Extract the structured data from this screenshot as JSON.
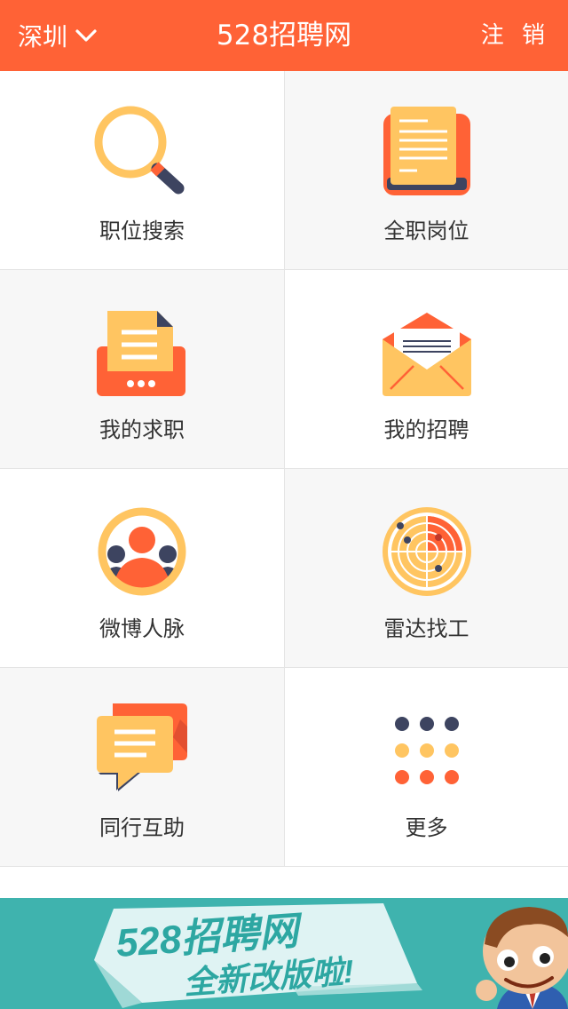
{
  "header": {
    "city": "深圳",
    "city_icon": "chevron-down-icon",
    "title": "528招聘网",
    "logout": "注 销"
  },
  "colors": {
    "header_bg": "#ff6236",
    "accent_orange": "#ff6236",
    "accent_yellow": "#ffc561",
    "dark_navy": "#3d4460",
    "banner_bg": "#3fb3ae"
  },
  "menu": [
    {
      "label": "职位搜索",
      "icon": "magnifier-icon"
    },
    {
      "label": "全职岗位",
      "icon": "document-stack-icon"
    },
    {
      "label": "我的求职",
      "icon": "printer-document-icon"
    },
    {
      "label": "我的招聘",
      "icon": "envelope-icon"
    },
    {
      "label": "微博人脉",
      "icon": "people-icon"
    },
    {
      "label": "雷达找工",
      "icon": "radar-icon"
    },
    {
      "label": "同行互助",
      "icon": "chat-bubbles-icon"
    },
    {
      "label": "更多",
      "icon": "dots-grid-icon"
    }
  ],
  "banner": {
    "line1": "528招聘网",
    "line2": "全新改版啦!"
  }
}
